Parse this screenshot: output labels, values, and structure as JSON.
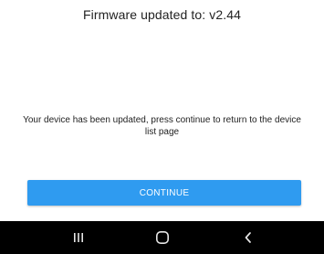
{
  "header": {
    "title": "Firmware updated to: v2.44"
  },
  "main": {
    "message": "Your device has been updated, press continue to return to the device list page",
    "continue_label": "CONTINUE"
  },
  "navbar": {
    "recents_icon": "recents-icon",
    "home_icon": "home-icon",
    "back_icon": "back-icon"
  },
  "colors": {
    "accent": "#2f9bf0",
    "navbar": "#000000",
    "nav_icon": "#e6e6e6"
  }
}
